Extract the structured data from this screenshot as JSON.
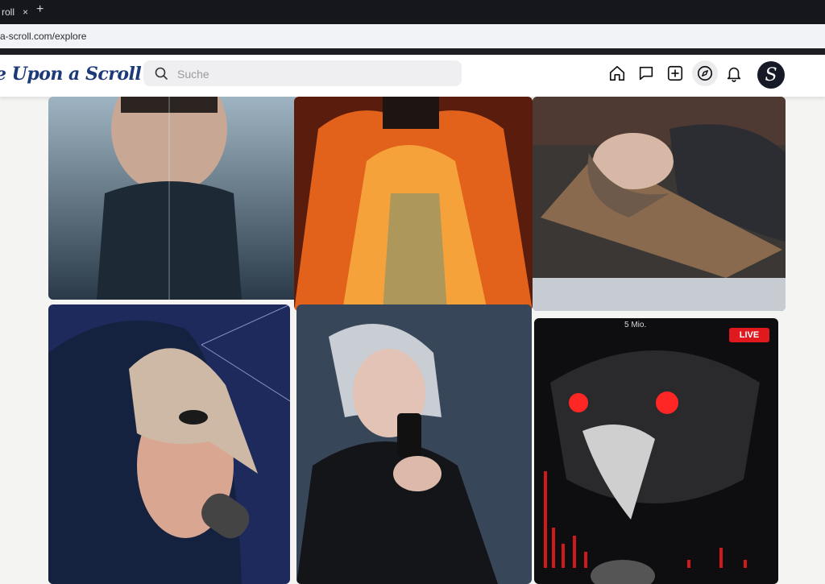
{
  "browser": {
    "tab_title": "roll",
    "tab_close": "×",
    "new_tab": "+",
    "url": "a-scroll.com/explore"
  },
  "header": {
    "logo": "e Upon a Scroll",
    "search_placeholder": "Suche",
    "avatar_letter": "S"
  },
  "nav_icons": [
    "home-icon",
    "messages-icon",
    "create-post-icon",
    "explore-icon",
    "notifications-icon"
  ],
  "feed": {
    "live_badge": "LIVE",
    "live_views": "5 Mio."
  },
  "colors": {
    "logo": "#1d3a78",
    "live": "#e0191f",
    "avatar": "#151a26"
  }
}
